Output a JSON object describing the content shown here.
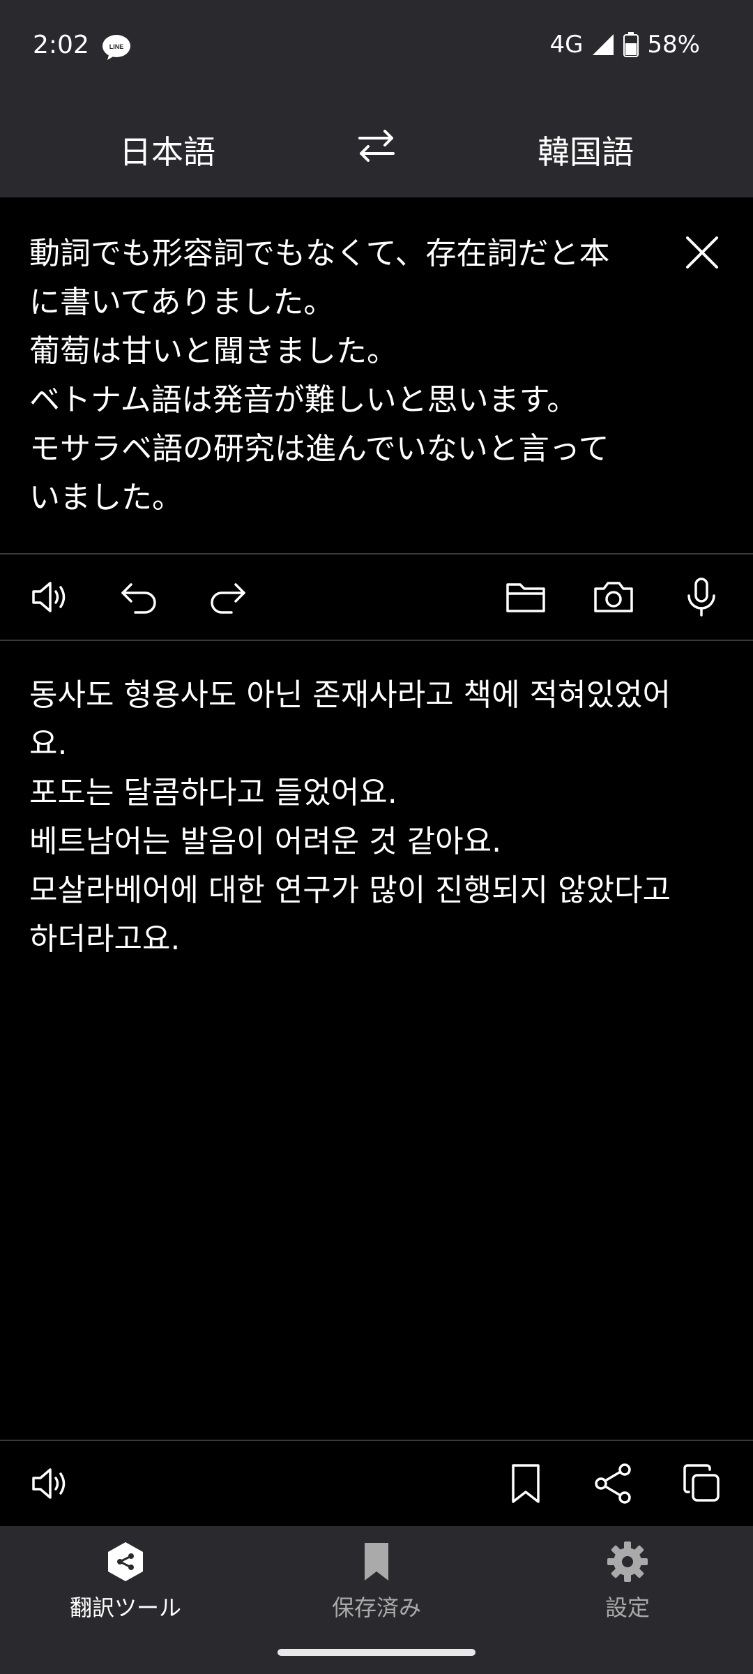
{
  "status": {
    "time": "2:02",
    "network": "4G",
    "battery": "58%"
  },
  "languages": {
    "source": "日本語",
    "target": "韓国語"
  },
  "source": {
    "text": "動詞でも形容詞でもなくて、存在詞だと本\nに書いてありました。\n葡萄は甘いと聞きました。\nベトナム語は発音が難しいと思います。\nモサラベ語の研究は進んでいないと言って\nいました。"
  },
  "translation": {
    "text": "동사도 형용사도 아닌 존재사라고 책에 적혀있었어\n요.\n포도는 달콤하다고 들었어요.\n베트남어는 발음이 어려운 것 같아요.\n모살라베어에 대한 연구가 많이 진행되지 않았다고\n하더라고요."
  },
  "nav": {
    "items": [
      {
        "label": "翻訳ツール",
        "icon": "translate-tool-icon",
        "active": true
      },
      {
        "label": "保存済み",
        "icon": "bookmark-icon",
        "active": false
      },
      {
        "label": "設定",
        "icon": "gear-icon",
        "active": false
      }
    ]
  },
  "colors": {
    "bar_background": "#2a2a2e",
    "content_background": "#000000",
    "text": "#ffffff",
    "inactive_nav": "#aaaaaa"
  }
}
